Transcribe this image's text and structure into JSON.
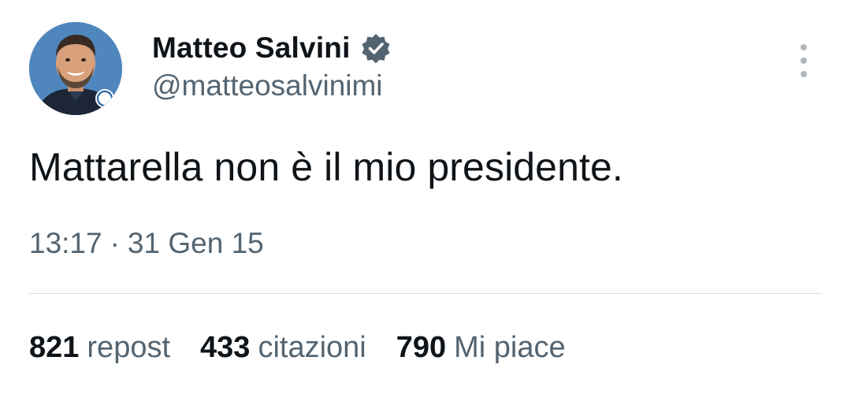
{
  "author": {
    "display_name": "Matteo Salvini",
    "handle": "@matteosalvinimi",
    "avatar_icon": "profile-photo-avatar",
    "verified_icon": "verified-badge-icon",
    "verified_color": "#536471"
  },
  "menu": {
    "icon": "more-options-icon"
  },
  "tweet": {
    "text": "Mattarella non è il mio presidente.",
    "time": "13:17",
    "separator": "·",
    "date": "31 Gen 15"
  },
  "stats": {
    "reposts": {
      "count": "821",
      "label": "repost"
    },
    "quotes": {
      "count": "433",
      "label": "citazioni"
    },
    "likes": {
      "count": "790",
      "label": "Mi piace"
    }
  },
  "colors": {
    "text_primary": "#0f1419",
    "text_secondary": "#536471",
    "divider": "#d9dee2"
  }
}
